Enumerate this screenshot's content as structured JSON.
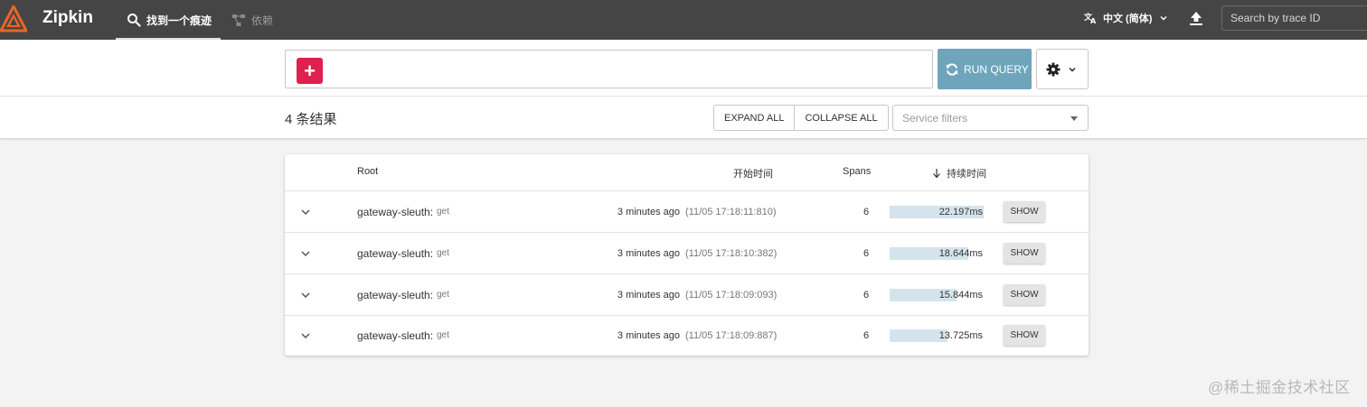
{
  "header": {
    "brand": "Zipkin",
    "tabs": [
      {
        "label": "找到一个痕迹",
        "active": true,
        "icon": "search-icon"
      },
      {
        "label": "依赖",
        "active": false,
        "icon": "dependency-graph-icon"
      }
    ],
    "language": "中文 (简体)",
    "trace_search_placeholder": "Search by trace ID"
  },
  "query": {
    "add_label": "+",
    "run_label": "RUN QUERY"
  },
  "results": {
    "count_label": "4 条结果",
    "expand_all": "EXPAND ALL",
    "collapse_all": "COLLAPSE ALL",
    "service_filter_placeholder": "Service filters"
  },
  "table": {
    "columns": {
      "root": "Root",
      "start_time": "开始时间",
      "spans": "Spans",
      "duration": "持续时间"
    },
    "rows": [
      {
        "service": "gateway-sleuth:",
        "operation": "get",
        "ago": "3 minutes ago",
        "timestamp": "(11/05 17:18:11:810)",
        "spans": "6",
        "duration": "22.197ms",
        "duration_fraction": 1.0,
        "show": "SHOW"
      },
      {
        "service": "gateway-sleuth:",
        "operation": "get",
        "ago": "3 minutes ago",
        "timestamp": "(11/05 17:18:10:382)",
        "spans": "6",
        "duration": "18.644ms",
        "duration_fraction": 0.84,
        "show": "SHOW"
      },
      {
        "service": "gateway-sleuth:",
        "operation": "get",
        "ago": "3 minutes ago",
        "timestamp": "(11/05 17:18:09:093)",
        "spans": "6",
        "duration": "15.844ms",
        "duration_fraction": 0.714,
        "show": "SHOW"
      },
      {
        "service": "gateway-sleuth:",
        "operation": "get",
        "ago": "3 minutes ago",
        "timestamp": "(11/05 17:18:09:887)",
        "spans": "6",
        "duration": "13.725ms",
        "duration_fraction": 0.618,
        "show": "SHOW"
      }
    ]
  },
  "watermark": "@稀土掘金技术社区",
  "colors": {
    "header_bg": "#454545",
    "accent_red": "#e0204e",
    "run_query_bg": "#6fa5bb",
    "duration_bar": "#d5e4ec",
    "logo_orange": "#e8652b"
  }
}
